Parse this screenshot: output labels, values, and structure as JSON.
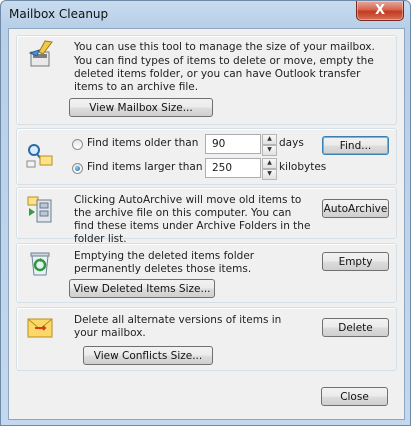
{
  "window": {
    "title": "Mailbox Cleanup",
    "close_glyph": "X"
  },
  "sections": {
    "manage": {
      "text": "You can use this tool to manage the size of your mailbox.",
      "text2": "You can find types of items to delete or move, empty the deleted items folder, or you can have Outlook transfer items to an archive file.",
      "button": "View Mailbox Size...",
      "icon": "broom-cleanup-icon"
    },
    "find": {
      "option_older": "Find items older than",
      "older_value": "90",
      "older_unit": "days",
      "option_larger": "Find items larger than",
      "larger_value": "250",
      "larger_unit": "kilobytes",
      "selected": "larger",
      "button": "Find...",
      "icon": "search-items-icon"
    },
    "archive": {
      "text": "Clicking AutoArchive will move old items to the archive file on this computer. You can find these items under Archive Folders in the folder list.",
      "button": "AutoArchive",
      "icon": "archive-cabinet-icon"
    },
    "deleted": {
      "text": "Emptying the deleted items folder permanently deletes those items.",
      "button_empty": "Empty",
      "button_view": "View Deleted Items Size...",
      "icon": "recycle-bin-icon"
    },
    "conflicts": {
      "text": "Delete all alternate versions of items in your mailbox.",
      "button_delete": "Delete",
      "button_view": "View Conflicts Size...",
      "icon": "conflict-envelope-icon"
    }
  },
  "footer": {
    "close_label": "Close"
  }
}
